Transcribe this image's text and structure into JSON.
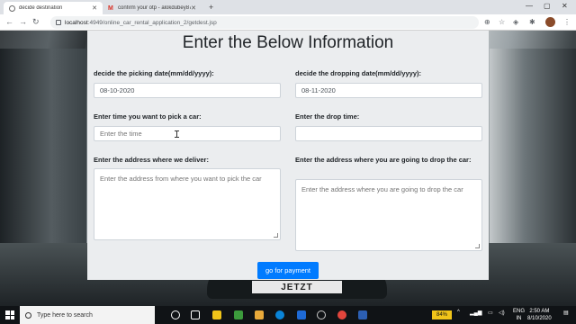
{
  "browser": {
    "tabs": [
      {
        "title": "decide destination",
        "active": true
      },
      {
        "title": "confirm your otp - alokdubey87@",
        "active": false
      }
    ],
    "url_host": "localhost",
    "url_path": ":4949/online_car_rental_application_2/getdest.jsp"
  },
  "form": {
    "heading": "Enter the Below Information",
    "pick_date_label": "decide the picking date(mm/dd/yyyy):",
    "pick_date_value": "08-10-2020",
    "drop_date_label": "decide the dropping date(mm/dd/yyyy):",
    "drop_date_value": "08-11-2020",
    "pick_time_label": "Enter time you want to pick a car:",
    "pick_time_placeholder": "Enter the time",
    "drop_time_label": "Enter the drop time:",
    "drop_time_placeholder": "",
    "deliver_address_label": "Enter the address where we deliver:",
    "deliver_address_placeholder": "Enter the address from where you want to pick the car",
    "drop_address_label": "Enter the address where you are going to drop the car:",
    "drop_address_placeholder": "Enter the address where you are going to drop the car",
    "submit_label": "go for payment"
  },
  "background": {
    "plate_text": "JETZT"
  },
  "taskbar": {
    "search_placeholder": "Type here to search",
    "battery": "84%",
    "lang_line1": "ENG",
    "lang_line2": "IN",
    "time": "2:50 AM",
    "date": "8/10/2020"
  },
  "colors": {
    "primary_button": "#007bff",
    "card_bg": "#ebedef"
  }
}
